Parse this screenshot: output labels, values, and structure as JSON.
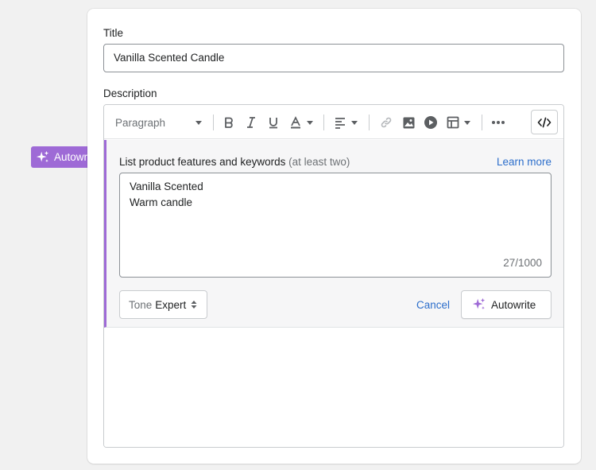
{
  "title_field": {
    "label": "Title",
    "value": "Vanilla Scented Candle"
  },
  "description": {
    "label": "Description"
  },
  "toolbar": {
    "paragraph_select": "Paragraph",
    "icons": [
      "bold-icon",
      "italic-icon",
      "underline-icon",
      "text-color-icon",
      "align-icon",
      "link-icon",
      "image-icon",
      "video-icon",
      "table-icon",
      "more-icon",
      "code-icon"
    ]
  },
  "autowrite_tag": {
    "label": "Autowrite",
    "color": "#9e6ad6"
  },
  "autowrite_panel": {
    "label": "List product features and keywords",
    "hint": "(at least two)",
    "learn_more": "Learn more",
    "keywords": [
      "Vanilla Scented",
      "Warm candle"
    ],
    "counter": "27/1000",
    "tone_label": "Tone",
    "tone_value": "Expert",
    "cancel": "Cancel",
    "submit": "Autowrite"
  },
  "colors": {
    "accent_purple": "#9e6ad6",
    "link_blue": "#2c6ecb"
  }
}
